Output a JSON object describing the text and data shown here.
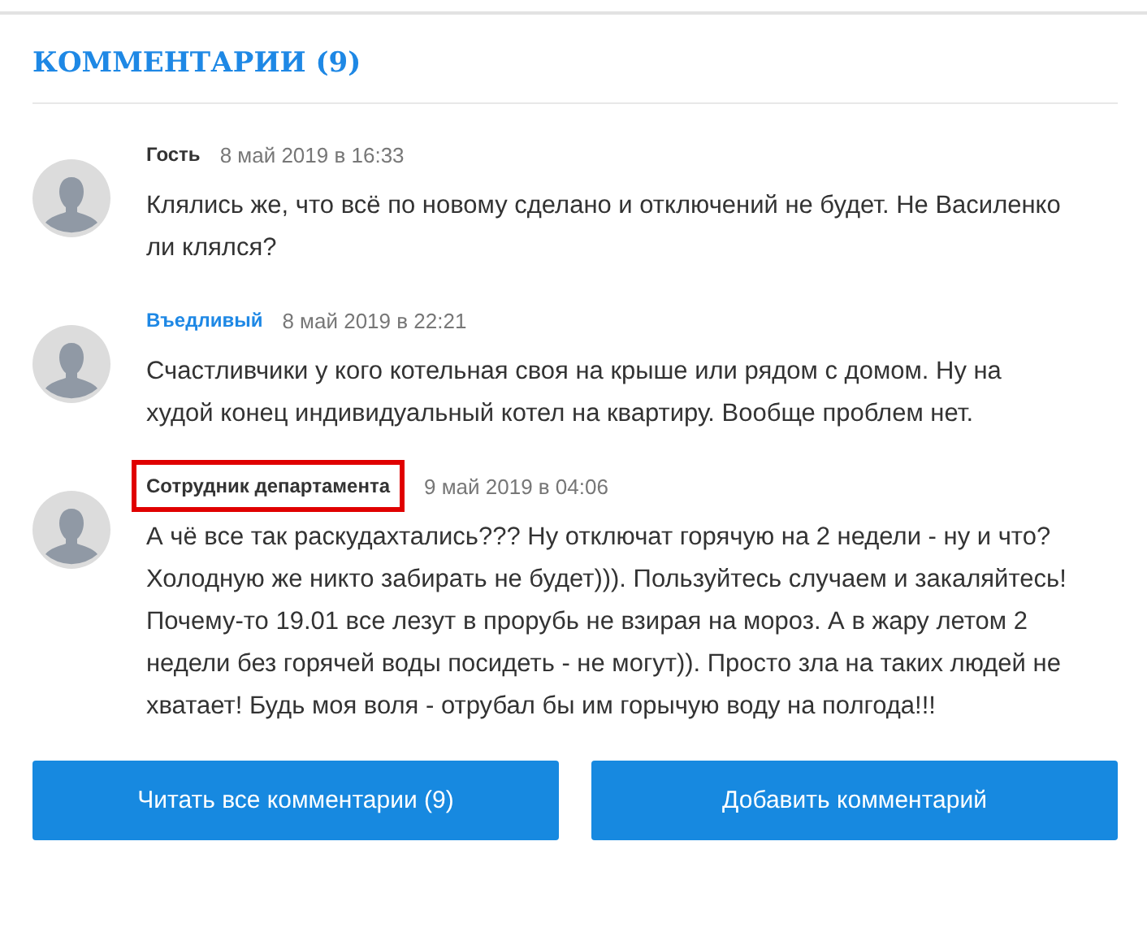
{
  "heading": "КОММЕНТАРИИ (9)",
  "comments": [
    {
      "author": "Гость",
      "registered": false,
      "highlighted": false,
      "date": "8 май 2019 в 16:33",
      "text": "Клялись же, что всё по новому сделано и отключений не будет. Не Василенко ли клялся?"
    },
    {
      "author": "Въедливый",
      "registered": true,
      "highlighted": false,
      "date": "8 май 2019 в 22:21",
      "text": "Счастливчики у кого котельная своя на крыше или рядом с домом. Ну на худой конец индивидуальный котел на квартиру. Вообще проблем нет."
    },
    {
      "author": "Сотрудник департамента",
      "registered": false,
      "highlighted": true,
      "date": "9 май 2019 в 04:06",
      "text": "А чё все так раскудахтались??? Ну отключат горячую на 2 недели - ну и что? Холодную же никто забирать не будет))). Пользуйтесь случаем и закаляйтесь! Почему-то 19.01 все лезут в прорубь не взирая на мороз. А в жару летом 2 недели без горячей воды посидеть - не могут)). Просто зла на таких людей не хватает! Будь моя воля - отрубал бы им горычую воду на полгода!!!"
    }
  ],
  "buttons": [
    "Читать все комментарии (9)",
    "Добавить комментарий"
  ]
}
